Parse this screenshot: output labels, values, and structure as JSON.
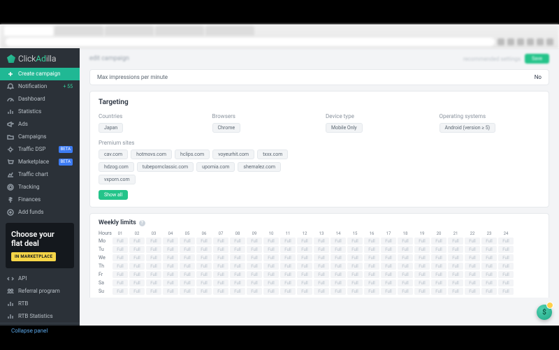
{
  "brand": {
    "pre": "Click",
    "accent": "Ad",
    "post": "illa"
  },
  "sidebar": {
    "items": [
      {
        "icon": "plus",
        "label": "Create campaign",
        "active": true
      },
      {
        "icon": "bell",
        "label": "Notification",
        "suffix": "+ 55"
      },
      {
        "icon": "gauge",
        "label": "Dashboard"
      },
      {
        "icon": "bars",
        "label": "Statistics"
      },
      {
        "icon": "megaphone",
        "label": "Ads"
      },
      {
        "icon": "folder",
        "label": "Campaigns"
      },
      {
        "icon": "cog",
        "label": "Traffic DSP",
        "badge": "BETA"
      },
      {
        "icon": "cart",
        "label": "Marketplace",
        "badge": "BETA"
      },
      {
        "icon": "chart",
        "label": "Traffic chart"
      },
      {
        "icon": "target",
        "label": "Tracking"
      },
      {
        "icon": "dollar",
        "label": "Finances"
      },
      {
        "icon": "plus-circle",
        "label": "Add funds"
      }
    ],
    "bottom": [
      {
        "icon": "code",
        "label": "API"
      },
      {
        "icon": "people",
        "label": "Referral program"
      },
      {
        "icon": "bars",
        "label": "RTB"
      },
      {
        "icon": "bars",
        "label": "RTB Statistics"
      }
    ],
    "collapse": "Collapse panel"
  },
  "promo": {
    "line1": "Choose your",
    "line2": "flat deal",
    "cta": "IN MARKETPLACE"
  },
  "topbar": {
    "left_blur": "edit campaign",
    "mid_blur": "recommended settings",
    "button": "Save"
  },
  "max_imp": {
    "label": "Max impressions per minute",
    "value": "No"
  },
  "targeting": {
    "title": "Targeting",
    "fields": [
      {
        "label": "Countries",
        "chips": [
          "Japan"
        ]
      },
      {
        "label": "Browsers",
        "chips": [
          "Chrome"
        ]
      },
      {
        "label": "Device type",
        "chips": [
          "Mobile Only"
        ]
      },
      {
        "label": "Operating systems",
        "chips": [
          "Android (version ≥ 5)"
        ]
      }
    ],
    "premium_label": "Premium sites",
    "premium_sites": [
      "cav.com",
      "hotmovs.com",
      "hclips.com",
      "voyeurhit.com",
      "txxx.com",
      "hdzog.com",
      "tubepornclassic.com",
      "upornia.com",
      "shemalez.com",
      "vxporn.com"
    ],
    "show_all": "Show all"
  },
  "weekly": {
    "title": "Weekly limits",
    "hours_label": "Hours",
    "hours": [
      "01",
      "02",
      "03",
      "04",
      "05",
      "06",
      "07",
      "08",
      "09",
      "10",
      "11",
      "12",
      "13",
      "14",
      "15",
      "16",
      "17",
      "18",
      "19",
      "20",
      "21",
      "22",
      "23",
      "24"
    ],
    "days": [
      "Mo",
      "Tu",
      "We",
      "Th",
      "Fr",
      "Sa",
      "Su"
    ],
    "cell_text": "Full"
  }
}
